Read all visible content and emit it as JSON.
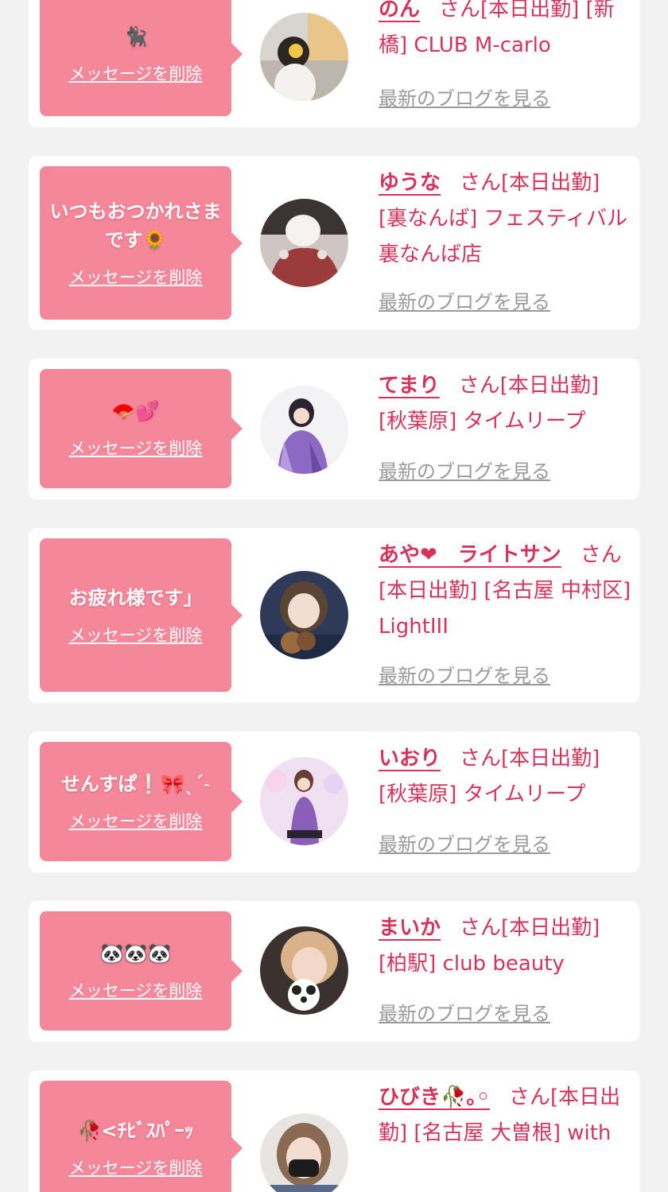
{
  "colors": {
    "page_background": "#f2f2f2",
    "card_background": "#ffffff",
    "bubble_pink": "#f48799",
    "name_red": "#d7335a",
    "link_gray": "#9a9a9a"
  },
  "common": {
    "delete_label": "メッセージを削除",
    "blog_label": "最新のブログを見る"
  },
  "cards": [
    {
      "message": "🐈‍⬛",
      "name": "のん",
      "info": "さん[本日出勤] [新橋] CLUB M-carlo"
    },
    {
      "message": "いつもおつかれさまです🌻",
      "name": "ゆうな",
      "info": "さん[本日出勤] [裏なんば] フェスティバル 裏なんば店"
    },
    {
      "message": "🪭💕",
      "name": "てまり",
      "info": "さん[本日出勤] [秋葉原] タイムリープ"
    },
    {
      "message": "お疲れ様です」",
      "name": "あや❤︎　ライトサン",
      "info": "さん[本日出勤] [名古屋 中村区] LightIII"
    },
    {
      "message": "せんすぱ❕🎀ˎˊ˗",
      "name": "いおり",
      "info": "さん[本日出勤] [秋葉原] タイムリープ"
    },
    {
      "message": "🐼🐼🐼",
      "name": "まいか",
      "info": "さん[本日出勤] [柏駅] club beauty"
    },
    {
      "message": "🥀<ﾁﾋﾞｽﾊﾟｰｯ",
      "name": "ひびき🥀｡◦",
      "info": "さん[本日出勤] [名古屋 大曽根] with"
    }
  ]
}
